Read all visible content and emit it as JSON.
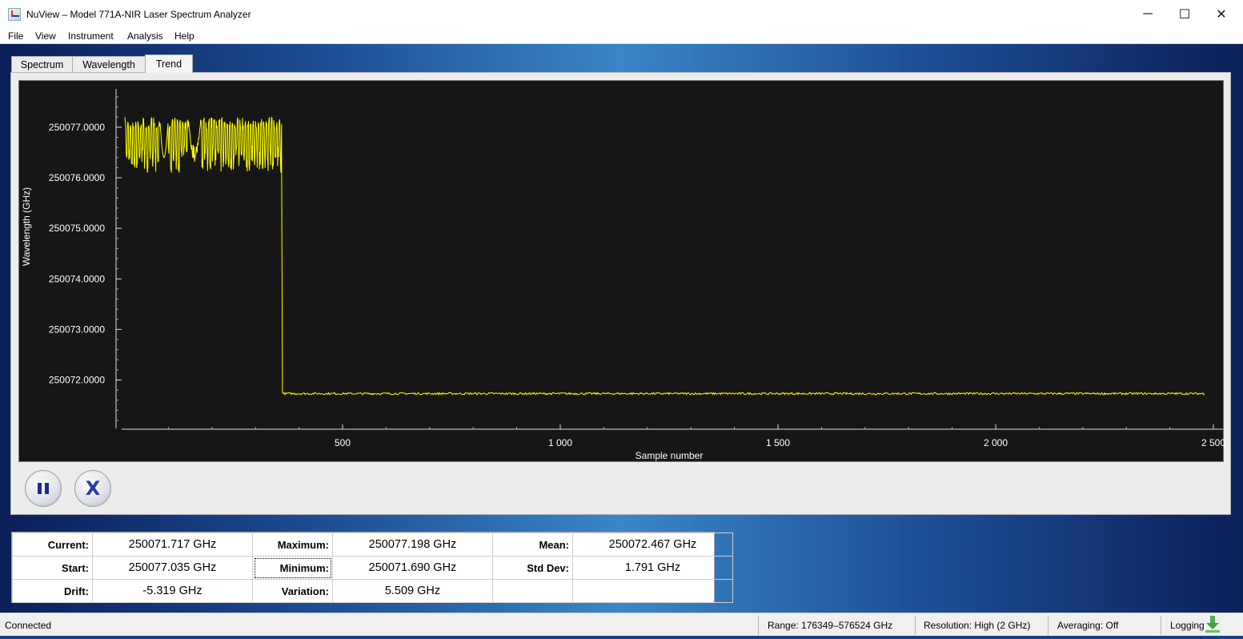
{
  "window": {
    "title": "NuView – Model 771A-NIR Laser Spectrum Analyzer",
    "controls": {
      "minimize": "─",
      "maximize": "☐",
      "close": "✕"
    }
  },
  "menu": [
    "File",
    "View",
    "Instrument",
    "Analysis",
    "Help"
  ],
  "tabs": [
    "Spectrum",
    "Wavelength",
    "Trend"
  ],
  "active_tab": "Trend",
  "chart_data": {
    "type": "line",
    "xlabel": "Sample number",
    "ylabel": "Wavelength (GHz)",
    "xlim": [
      0,
      2500
    ],
    "ylim": [
      250071.2,
      250077.6
    ],
    "x_ticks": [
      500,
      1000,
      1500,
      2000,
      2500
    ],
    "x_tick_labels": [
      "500",
      "1 000",
      "1 500",
      "2 000",
      "2 500"
    ],
    "y_ticks": [
      250072,
      250073,
      250074,
      250075,
      250076,
      250077
    ],
    "y_tick_labels": [
      "250072.0000",
      "250073.0000",
      "250074.0000",
      "250075.0000",
      "250076.0000",
      "250077.0000"
    ],
    "grid": false,
    "series": [
      {
        "color": "#ffff00",
        "segments": [
          {
            "x_start": 0,
            "x_end": 360,
            "min": 250076.1,
            "max": 250077.2,
            "pattern": "oscillating"
          },
          {
            "x": 360,
            "value": 250076.55
          },
          {
            "x": 362,
            "value": 250071.75
          },
          {
            "x_start": 362,
            "x_end": 2480,
            "mean": 250071.73,
            "noise": 0.02,
            "pattern": "flat"
          }
        ]
      }
    ]
  },
  "controls": {
    "pause": "pause-icon",
    "clear": "close-icon"
  },
  "stats": {
    "rows": [
      [
        {
          "label": "Current:",
          "value": "250071.717 GHz"
        },
        {
          "label": "Maximum:",
          "value": "250077.198 GHz"
        },
        {
          "label": "Mean:",
          "value": "250072.467 GHz"
        }
      ],
      [
        {
          "label": "Start:",
          "value": "250077.035 GHz"
        },
        {
          "label": "Minimum:",
          "value": "250071.690 GHz"
        },
        {
          "label": "Std Dev:",
          "value": "1.791 GHz"
        }
      ],
      [
        {
          "label": "Drift:",
          "value": "-5.319 GHz"
        },
        {
          "label": "Variation:",
          "value": "5.509 GHz"
        },
        {
          "label": "",
          "value": ""
        }
      ]
    ]
  },
  "status": {
    "connection": "Connected",
    "range": "Range:  176349–576524 GHz",
    "resolution": "Resolution:  High (2 GHz)",
    "averaging": "Averaging:  Off",
    "logging": "Logging"
  },
  "colors": {
    "plot_background": "#161616",
    "trace": "#ffff00",
    "axis_text": "#ffffff"
  }
}
